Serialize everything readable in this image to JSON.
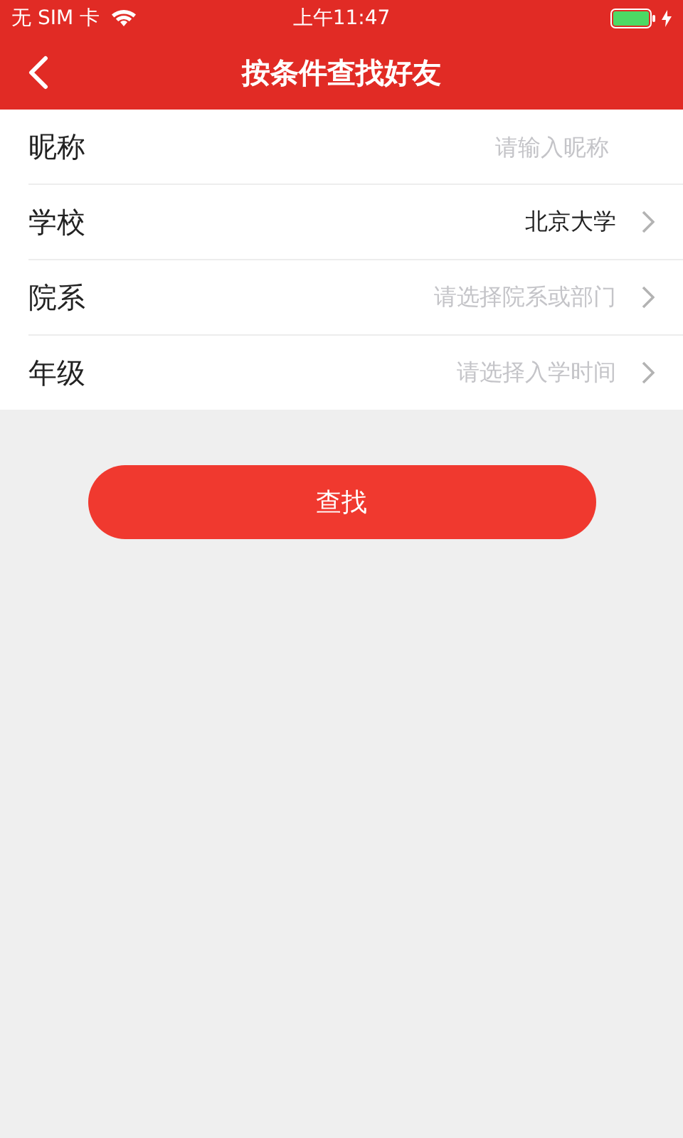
{
  "status_bar": {
    "carrier": "无 SIM 卡",
    "time": "上午11:47"
  },
  "nav": {
    "title": "按条件查找好友"
  },
  "form": [
    {
      "kind": "input",
      "label": "昵称",
      "placeholder": "请输入昵称"
    },
    {
      "kind": "select",
      "label": "学校",
      "value": "北京大学"
    },
    {
      "kind": "select",
      "label": "院系",
      "placeholder": "请选择院系或部门"
    },
    {
      "kind": "select",
      "label": "年级",
      "placeholder": "请选择入学时间"
    }
  ],
  "search_button": "查找"
}
